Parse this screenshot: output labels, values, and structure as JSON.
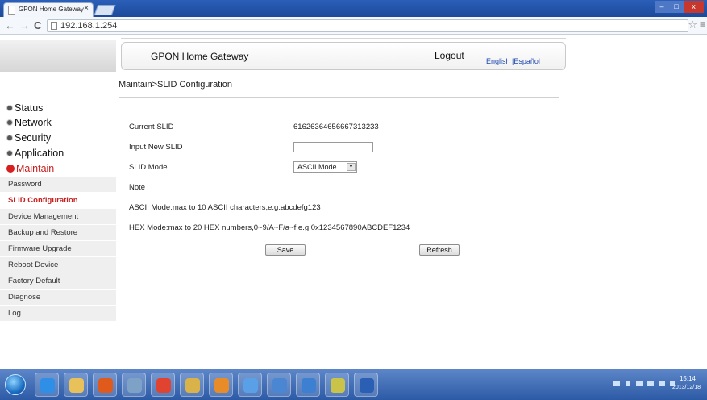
{
  "browser": {
    "tab_title": "GPON Home Gateway",
    "tab_close": "×",
    "url": "192.168.1.254",
    "back": "←",
    "forward": "→",
    "reload": "C",
    "star": "☆",
    "menu": "≡",
    "window_controls": {
      "minimize": "–",
      "maximize": "□",
      "close": "x"
    }
  },
  "header": {
    "brand": "GPON Home Gateway",
    "logout": "Logout",
    "language": "English |Español"
  },
  "breadcrumb": "Maintain>SLID Configuration",
  "sidebar": {
    "categories": [
      {
        "label": "Status",
        "active": false
      },
      {
        "label": "Network",
        "active": false
      },
      {
        "label": "Security",
        "active": false
      },
      {
        "label": "Application",
        "active": false
      },
      {
        "label": "Maintain",
        "active": true
      }
    ],
    "items": [
      {
        "label": "Password",
        "active": false
      },
      {
        "label": "SLID Configuration",
        "active": true
      },
      {
        "label": "Device Management",
        "active": false
      },
      {
        "label": "Backup and Restore",
        "active": false
      },
      {
        "label": "Firmware Upgrade",
        "active": false
      },
      {
        "label": "Reboot Device",
        "active": false
      },
      {
        "label": "Factory Default",
        "active": false
      },
      {
        "label": "Diagnose",
        "active": false
      },
      {
        "label": "Log",
        "active": false
      }
    ]
  },
  "form": {
    "current_slid_label": "Current SLID",
    "current_slid_value": "61626364656667313233",
    "new_slid_label": "Input New SLID",
    "new_slid_value": "",
    "mode_label": "SLID Mode",
    "mode_selected": "ASCII Mode",
    "note_label": "Note",
    "note_ascii": "ASCII Mode:max to 10 ASCII characters,e.g.abcdefg123",
    "note_hex": "HEX Mode:max to 20 HEX numbers,0~9/A~F/a~f,e.g.0x1234567890ABCDEF1234",
    "save": "Save",
    "refresh": "Refresh"
  },
  "taskbar": {
    "time": "15:14",
    "date": "2013/12/18",
    "app_icons": [
      {
        "name": "ie-icon",
        "color": "#2f8ee6"
      },
      {
        "name": "explorer-icon",
        "color": "#e9c15a"
      },
      {
        "name": "media-player-icon",
        "color": "#e05a1c"
      },
      {
        "name": "calculator-icon",
        "color": "#7da2c6"
      },
      {
        "name": "chrome-icon",
        "color": "#e0432f"
      },
      {
        "name": "notepad-icon",
        "color": "#d9b24a"
      },
      {
        "name": "paint-icon",
        "color": "#e88c2a"
      },
      {
        "name": "network-icon",
        "color": "#5aa0e6"
      },
      {
        "name": "user-icon",
        "color": "#4a86d1"
      },
      {
        "name": "remote-icon",
        "color": "#3d7fd0"
      },
      {
        "name": "tool-icon",
        "color": "#c9c34a"
      },
      {
        "name": "word-icon",
        "color": "#2b5fb4"
      }
    ]
  }
}
